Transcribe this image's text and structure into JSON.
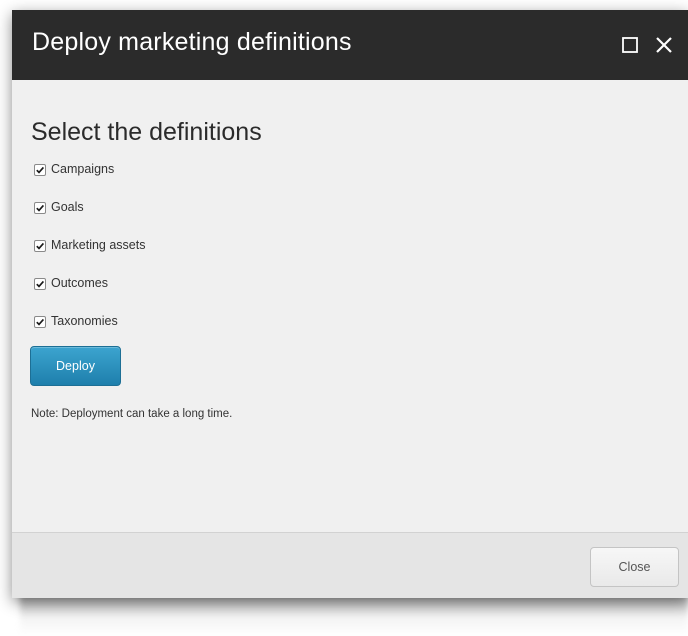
{
  "dialog": {
    "title": "Deploy marketing definitions",
    "maximize_icon": "maximize-icon",
    "close_icon": "close-icon"
  },
  "content": {
    "heading": "Select the definitions",
    "checkboxes": [
      {
        "label": "Campaigns",
        "checked": true
      },
      {
        "label": "Goals",
        "checked": true
      },
      {
        "label": "Marketing assets",
        "checked": true
      },
      {
        "label": "Outcomes",
        "checked": true
      },
      {
        "label": "Taxonomies",
        "checked": true
      }
    ],
    "deploy_label": "Deploy",
    "note": "Note: Deployment can take a long time."
  },
  "footer": {
    "close_label": "Close"
  },
  "colors": {
    "titlebar": "#2b2b2b",
    "body": "#f0f0f0",
    "footer": "#e5e5e5",
    "primary_button": "#2a8fbd"
  }
}
